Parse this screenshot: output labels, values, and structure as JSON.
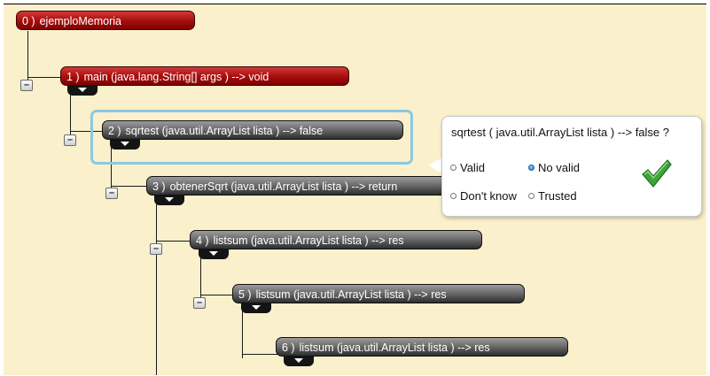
{
  "tree": {
    "nodes": [
      {
        "index": "0 )",
        "label": "ejemploMemoria",
        "style": "red"
      },
      {
        "index": "1 )",
        "label": "main (java.lang.String[] args ) --> void",
        "style": "red"
      },
      {
        "index": "2 )",
        "label": "sqrtest (java.util.ArrayList lista ) --> false",
        "style": "gray",
        "selected": true
      },
      {
        "index": "3 )",
        "label": "obtenerSqrt (java.util.ArrayList lista ) --> return",
        "style": "gray"
      },
      {
        "index": "4 )",
        "label": "listsum (java.util.ArrayList lista ) --> res",
        "style": "gray"
      },
      {
        "index": "5 )",
        "label": "listsum (java.util.ArrayList lista ) --> res",
        "style": "gray"
      },
      {
        "index": "6 )",
        "label": "listsum (java.util.ArrayList lista ) --> res",
        "style": "gray"
      }
    ],
    "toggle_symbol": "–"
  },
  "question": {
    "text": "sqrtest ( java.util.ArrayList lista ) --> false ?",
    "options": {
      "valid": "Valid",
      "no_valid": "No valid",
      "dont_know": "Don't know",
      "trusted": "Trusted"
    },
    "selected_option": "no_valid",
    "confirm_icon": "checkmark-icon",
    "confirm_color": "#3aa63a"
  },
  "colors": {
    "background": "#faf0cc",
    "selection_frame": "#89c9e3"
  }
}
